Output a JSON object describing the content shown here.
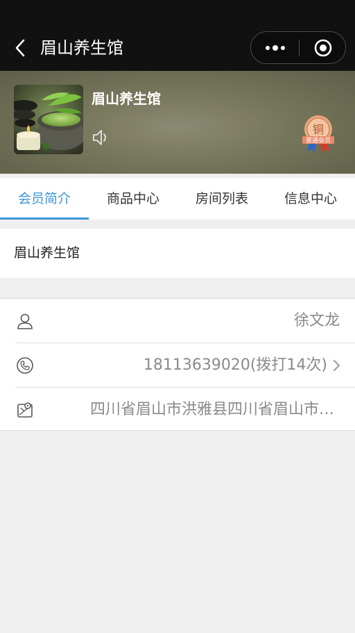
{
  "nav": {
    "title": "眉山养生馆"
  },
  "header": {
    "shop_name": "眉山养生馆",
    "badge": {
      "medal_char": "铜",
      "level": "普通会员"
    }
  },
  "tabs": [
    {
      "label": "会员简介",
      "active": true
    },
    {
      "label": "商品中心",
      "active": false
    },
    {
      "label": "房间列表",
      "active": false
    },
    {
      "label": "信息中心",
      "active": false
    }
  ],
  "intro": {
    "text": "眉山养生馆"
  },
  "info": {
    "contact_name": "徐文龙",
    "phone": "18113639020(拨打14次)",
    "address": "四川省眉山市洪雅县四川省眉山市洪雅县"
  },
  "colors": {
    "accent": "#3d96d6",
    "titlebar": "#111111",
    "header": "#76765c"
  },
  "icons": [
    "back-arrow-icon",
    "more-dots-icon",
    "close-circle-icon",
    "speaker-icon",
    "user-icon",
    "phone-icon",
    "map-location-icon",
    "chevron-right-icon"
  ]
}
